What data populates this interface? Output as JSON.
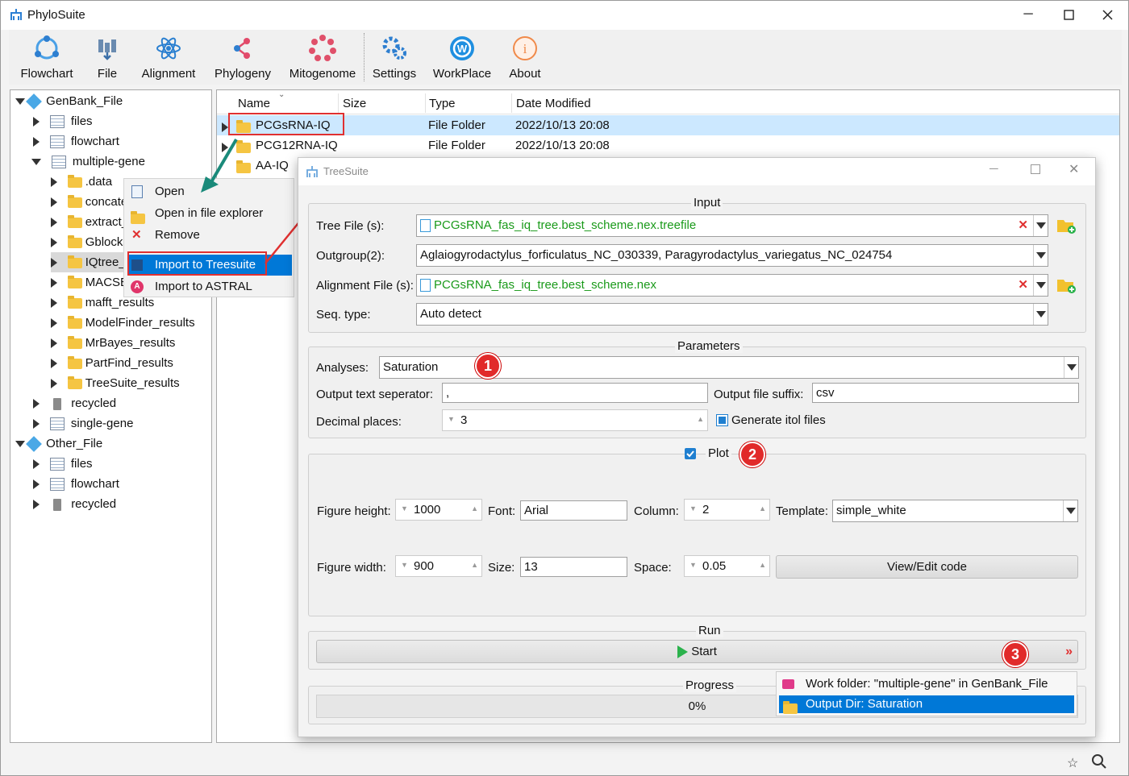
{
  "window": {
    "app_title": "PhyloSuite",
    "controls": [
      "minimize",
      "maximize",
      "close"
    ]
  },
  "toolbar": [
    {
      "label": "Flowchart",
      "icon": "flowchart-icon"
    },
    {
      "label": "File",
      "icon": "file-icon"
    },
    {
      "label": "Alignment",
      "icon": "alignment-icon"
    },
    {
      "label": "Phylogeny",
      "icon": "phylogeny-icon"
    },
    {
      "label": "Mitogenome",
      "icon": "mitogenome-icon"
    },
    {
      "label": "Settings",
      "icon": "settings-icon"
    },
    {
      "label": "WorkPlace",
      "icon": "workplace-icon"
    },
    {
      "label": "About",
      "icon": "about-icon"
    }
  ],
  "tree": {
    "genbank_root": "GenBank_File",
    "genbank_children": [
      "files",
      "flowchart",
      "multiple-gene"
    ],
    "multiple_gene_children": [
      ".data",
      "concate",
      "extract_",
      "Gblocks",
      "IQtree_",
      "MACSE",
      "mafft_results",
      "ModelFinder_results",
      "MrBayes_results",
      "PartFind_results",
      "TreeSuite_results"
    ],
    "genbank_tail": [
      "recycled",
      "single-gene"
    ],
    "other_root": "Other_File",
    "other_children": [
      "files",
      "flowchart",
      "recycled"
    ]
  },
  "file_list": {
    "headers": [
      "Name",
      "Size",
      "Type",
      "Date Modified"
    ],
    "rows": [
      {
        "name": "PCGsRNA-IQ",
        "type": "File Folder",
        "date": "2022/10/13 20:08"
      },
      {
        "name": "PCG12RNA-IQ",
        "type": "File Folder",
        "date": "2022/10/13 20:08"
      },
      {
        "name": "AA-IQ",
        "type": "",
        "date": ""
      }
    ]
  },
  "context_menu": [
    "Open",
    "Open in file explorer",
    "Remove",
    "Import to Treesuite",
    "Import to ASTRAL"
  ],
  "treesuite": {
    "title": "TreeSuite",
    "input": {
      "group_title": "Input",
      "tree_file_label": "Tree File (s):",
      "tree_file_value": "PCGsRNA_fas_iq_tree.best_scheme.nex.treefile",
      "outgroup_label": "Outgroup(2):",
      "outgroup_value": "Aglaiogyrodactylus_forficulatus_NC_030339, Paragyrodactylus_variegatus_NC_024754",
      "alignment_label": "Alignment File (s):",
      "alignment_value": "PCGsRNA_fas_iq_tree.best_scheme.nex",
      "seqtype_label": "Seq. type:",
      "seqtype_value": "Auto detect"
    },
    "params": {
      "group_title": "Parameters",
      "analyses_label": "Analyses:",
      "analyses_value": "Saturation",
      "sep_label": "Output text seperator:",
      "sep_value": ",",
      "suffix_label": "Output file suffix:",
      "suffix_value": "csv",
      "decimal_label": "Decimal places:",
      "decimal_value": "3",
      "itol_label": "Generate itol files",
      "itol_checked": true
    },
    "plot": {
      "group_title": "Plot",
      "checked": true,
      "height_label": "Figure height:",
      "height_value": "1000",
      "font_label": "Font:",
      "font_value": "Arial",
      "column_label": "Column:",
      "column_value": "2",
      "template_label": "Template:",
      "template_value": "simple_white",
      "width_label": "Figure width:",
      "width_value": "900",
      "size_label": "Size:",
      "size_value": "13",
      "space_label": "Space:",
      "space_value": "0.05",
      "code_button": "View/Edit code"
    },
    "run": {
      "group_title": "Run",
      "start_label": "Start"
    },
    "progress": {
      "group_title": "Progress",
      "value_text": "0%",
      "fraction": 0
    },
    "dropdown": [
      "Work folder: \"multiple-gene\" in GenBank_File",
      "Output Dir: Saturation"
    ],
    "badges": [
      "1",
      "2",
      "3"
    ]
  },
  "colors": {
    "accent": "#0078d7",
    "selection": "#cce8ff",
    "badge": "#e12a2a",
    "green_path": "#1a9a1a",
    "annotation": "#e03030"
  }
}
